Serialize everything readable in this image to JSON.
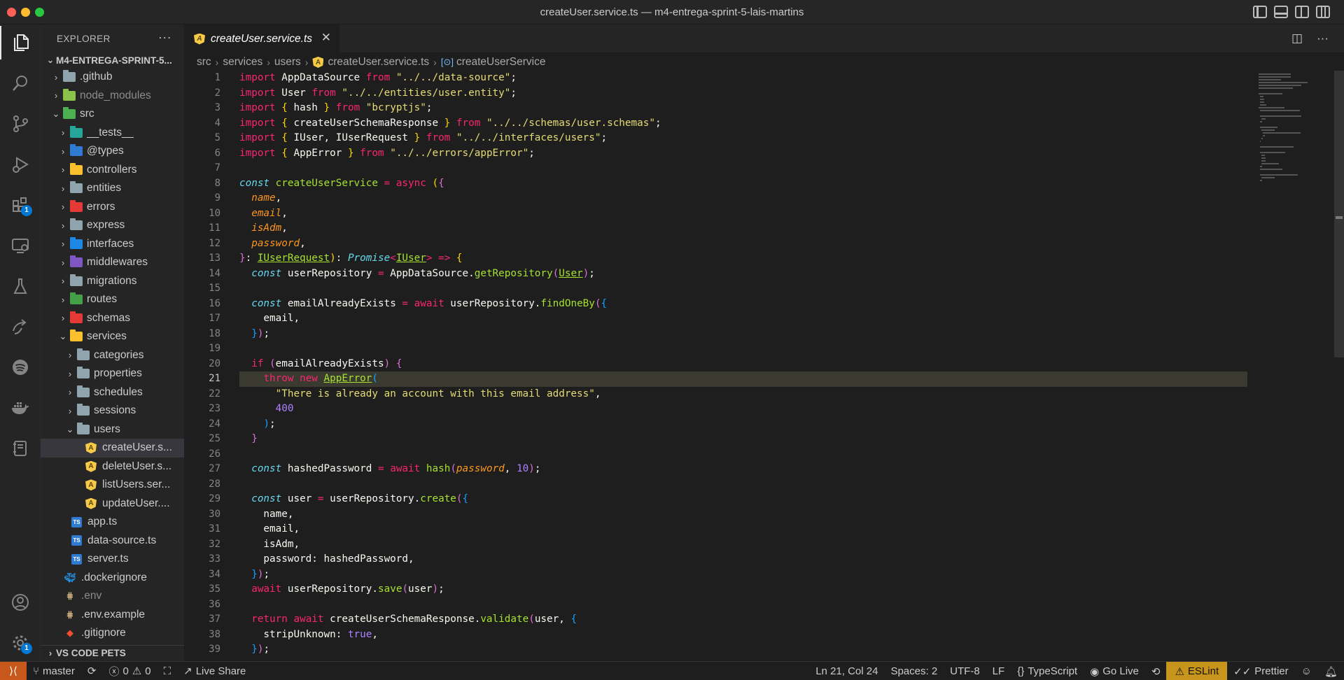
{
  "window": {
    "title": "createUser.service.ts — m4-entrega-sprint-5-lais-martins"
  },
  "activity_bar": {
    "extensions_badge": "1",
    "settings_badge": "1"
  },
  "sidebar": {
    "header": "EXPLORER",
    "root": "M4-ENTREGA-SPRINT-5...",
    "footer": "VS CODE PETS",
    "tree": [
      {
        "label": ".github",
        "kind": "folder",
        "depth": 1,
        "open": false,
        "color": "#90a4ae"
      },
      {
        "label": "node_modules",
        "kind": "folder",
        "depth": 1,
        "open": false,
        "color": "#8bc34a",
        "dim": true
      },
      {
        "label": "src",
        "kind": "folder",
        "depth": 1,
        "open": true,
        "color": "#4caf50"
      },
      {
        "label": "__tests__",
        "kind": "folder",
        "depth": 2,
        "open": false,
        "color": "#26a69a"
      },
      {
        "label": "@types",
        "kind": "folder",
        "depth": 2,
        "open": false,
        "color": "#2f7bd1"
      },
      {
        "label": "controllers",
        "kind": "folder",
        "depth": 2,
        "open": false,
        "color": "#fbc02d"
      },
      {
        "label": "entities",
        "kind": "folder",
        "depth": 2,
        "open": false,
        "color": "#90a4ae"
      },
      {
        "label": "errors",
        "kind": "folder",
        "depth": 2,
        "open": false,
        "color": "#e53935"
      },
      {
        "label": "express",
        "kind": "folder",
        "depth": 2,
        "open": false,
        "color": "#90a4ae"
      },
      {
        "label": "interfaces",
        "kind": "folder",
        "depth": 2,
        "open": false,
        "color": "#1e88e5"
      },
      {
        "label": "middlewares",
        "kind": "folder",
        "depth": 2,
        "open": false,
        "color": "#7e57c2"
      },
      {
        "label": "migrations",
        "kind": "folder",
        "depth": 2,
        "open": false,
        "color": "#90a4ae"
      },
      {
        "label": "routes",
        "kind": "folder",
        "depth": 2,
        "open": false,
        "color": "#43a047"
      },
      {
        "label": "schemas",
        "kind": "folder",
        "depth": 2,
        "open": false,
        "color": "#e53935"
      },
      {
        "label": "services",
        "kind": "folder",
        "depth": 2,
        "open": true,
        "color": "#fbc02d"
      },
      {
        "label": "categories",
        "kind": "folder",
        "depth": 3,
        "open": false,
        "color": "#90a4ae"
      },
      {
        "label": "properties",
        "kind": "folder",
        "depth": 3,
        "open": false,
        "color": "#90a4ae"
      },
      {
        "label": "schedules",
        "kind": "folder",
        "depth": 3,
        "open": false,
        "color": "#90a4ae"
      },
      {
        "label": "sessions",
        "kind": "folder",
        "depth": 3,
        "open": false,
        "color": "#90a4ae"
      },
      {
        "label": "users",
        "kind": "folder",
        "depth": 3,
        "open": true,
        "color": "#90a4ae"
      },
      {
        "label": "createUser.s...",
        "kind": "angular",
        "depth": 4,
        "selected": true
      },
      {
        "label": "deleteUser.s...",
        "kind": "angular",
        "depth": 4
      },
      {
        "label": "listUsers.ser...",
        "kind": "angular",
        "depth": 4
      },
      {
        "label": "updateUser....",
        "kind": "angular",
        "depth": 4
      },
      {
        "label": "app.ts",
        "kind": "ts",
        "depth": 2
      },
      {
        "label": "data-source.ts",
        "kind": "ts",
        "depth": 2
      },
      {
        "label": "server.ts",
        "kind": "ts",
        "depth": 2
      },
      {
        "label": ".dockerignore",
        "kind": "docker",
        "depth": 1
      },
      {
        "label": ".env",
        "kind": "env",
        "depth": 1,
        "dim": true
      },
      {
        "label": ".env.example",
        "kind": "env",
        "depth": 1
      },
      {
        "label": ".gitignore",
        "kind": "git",
        "depth": 1
      }
    ]
  },
  "tab": {
    "label": "createUser.service.ts"
  },
  "breadcrumb": [
    "src",
    "services",
    "users",
    "createUser.service.ts",
    "createUserService"
  ],
  "editor": {
    "current_line": 21,
    "lines": [
      [
        [
          "kw",
          "import"
        ],
        [
          "p",
          " AppDataSource "
        ],
        [
          "kw",
          "from"
        ],
        [
          "p",
          " "
        ],
        [
          "str",
          "\"../../data-source\""
        ],
        [
          "p",
          ";"
        ]
      ],
      [
        [
          "kw",
          "import"
        ],
        [
          "p",
          " User "
        ],
        [
          "kw",
          "from"
        ],
        [
          "p",
          " "
        ],
        [
          "str",
          "\"../../entities/user.entity\""
        ],
        [
          "p",
          ";"
        ]
      ],
      [
        [
          "kw",
          "import"
        ],
        [
          "p",
          " "
        ],
        [
          "b1",
          "{"
        ],
        [
          "p",
          " hash "
        ],
        [
          "b1",
          "}"
        ],
        [
          "p",
          " "
        ],
        [
          "kw",
          "from"
        ],
        [
          "p",
          " "
        ],
        [
          "str",
          "\"bcryptjs\""
        ],
        [
          "p",
          ";"
        ]
      ],
      [
        [
          "kw",
          "import"
        ],
        [
          "p",
          " "
        ],
        [
          "b1",
          "{"
        ],
        [
          "p",
          " createUserSchemaResponse "
        ],
        [
          "b1",
          "}"
        ],
        [
          "p",
          " "
        ],
        [
          "kw",
          "from"
        ],
        [
          "p",
          " "
        ],
        [
          "str",
          "\"../../schemas/user.schemas\""
        ],
        [
          "p",
          ";"
        ]
      ],
      [
        [
          "kw",
          "import"
        ],
        [
          "p",
          " "
        ],
        [
          "b1",
          "{"
        ],
        [
          "p",
          " IUser, IUserRequest "
        ],
        [
          "b1",
          "}"
        ],
        [
          "p",
          " "
        ],
        [
          "kw",
          "from"
        ],
        [
          "p",
          " "
        ],
        [
          "str",
          "\"../../interfaces/users\""
        ],
        [
          "p",
          ";"
        ]
      ],
      [
        [
          "kw",
          "import"
        ],
        [
          "p",
          " "
        ],
        [
          "b1",
          "{"
        ],
        [
          "p",
          " AppError "
        ],
        [
          "b1",
          "}"
        ],
        [
          "p",
          " "
        ],
        [
          "kw",
          "from"
        ],
        [
          "p",
          " "
        ],
        [
          "str",
          "\"../../errors/appError\""
        ],
        [
          "p",
          ";"
        ]
      ],
      [],
      [
        [
          "kw2",
          "const"
        ],
        [
          "p",
          " "
        ],
        [
          "fn",
          "createUserService"
        ],
        [
          "p",
          " "
        ],
        [
          "kw",
          "="
        ],
        [
          "p",
          " "
        ],
        [
          "kw",
          "async"
        ],
        [
          "p",
          " "
        ],
        [
          "b1",
          "("
        ],
        [
          "b2",
          "{"
        ]
      ],
      [
        [
          "p",
          "  "
        ],
        [
          "param",
          "name"
        ],
        [
          "p",
          ","
        ]
      ],
      [
        [
          "p",
          "  "
        ],
        [
          "param",
          "email"
        ],
        [
          "p",
          ","
        ]
      ],
      [
        [
          "p",
          "  "
        ],
        [
          "param",
          "isAdm"
        ],
        [
          "p",
          ","
        ]
      ],
      [
        [
          "p",
          "  "
        ],
        [
          "param",
          "password"
        ],
        [
          "p",
          ","
        ]
      ],
      [
        [
          "b2",
          "}"
        ],
        [
          "p",
          ": "
        ],
        [
          "ty",
          "IUserRequest"
        ],
        [
          "b1",
          ")"
        ],
        [
          "p",
          ": "
        ],
        [
          "tyi",
          "Promise"
        ],
        [
          "kw",
          "<"
        ],
        [
          "ty",
          "IUser"
        ],
        [
          "kw",
          ">"
        ],
        [
          "p",
          " "
        ],
        [
          "kw",
          "=>"
        ],
        [
          "p",
          " "
        ],
        [
          "b1",
          "{"
        ]
      ],
      [
        [
          "p",
          "  "
        ],
        [
          "kw2",
          "const"
        ],
        [
          "p",
          " userRepository "
        ],
        [
          "kw",
          "="
        ],
        [
          "p",
          " AppDataSource."
        ],
        [
          "fn",
          "getRepository"
        ],
        [
          "b2",
          "("
        ],
        [
          "ty",
          "User"
        ],
        [
          "b2",
          ")"
        ],
        [
          "p",
          ";"
        ]
      ],
      [],
      [
        [
          "p",
          "  "
        ],
        [
          "kw2",
          "const"
        ],
        [
          "p",
          " emailAlreadyExists "
        ],
        [
          "kw",
          "="
        ],
        [
          "p",
          " "
        ],
        [
          "kw",
          "await"
        ],
        [
          "p",
          " userRepository."
        ],
        [
          "fn",
          "findOneBy"
        ],
        [
          "b2",
          "("
        ],
        [
          "b3",
          "{"
        ]
      ],
      [
        [
          "p",
          "    email,"
        ]
      ],
      [
        [
          "p",
          "  "
        ],
        [
          "b3",
          "}"
        ],
        [
          "b2",
          ")"
        ],
        [
          "p",
          ";"
        ]
      ],
      [],
      [
        [
          "p",
          "  "
        ],
        [
          "kw",
          "if"
        ],
        [
          "p",
          " "
        ],
        [
          "b2",
          "("
        ],
        [
          "p",
          "emailAlreadyExists"
        ],
        [
          "b2",
          ")"
        ],
        [
          "p",
          " "
        ],
        [
          "b2",
          "{"
        ]
      ],
      [
        [
          "p",
          "    "
        ],
        [
          "kw",
          "throw"
        ],
        [
          "p",
          " "
        ],
        [
          "kw",
          "new"
        ],
        [
          "p",
          " "
        ],
        [
          "ty",
          "AppError"
        ],
        [
          "b3",
          "("
        ]
      ],
      [
        [
          "p",
          "      "
        ],
        [
          "str",
          "\"There is already an account with this email address\""
        ],
        [
          "p",
          ","
        ]
      ],
      [
        [
          "p",
          "      "
        ],
        [
          "num",
          "400"
        ]
      ],
      [
        [
          "p",
          "    "
        ],
        [
          "b3",
          ")"
        ],
        [
          "p",
          ";"
        ]
      ],
      [
        [
          "p",
          "  "
        ],
        [
          "b2",
          "}"
        ]
      ],
      [],
      [
        [
          "p",
          "  "
        ],
        [
          "kw2",
          "const"
        ],
        [
          "p",
          " hashedPassword "
        ],
        [
          "kw",
          "="
        ],
        [
          "p",
          " "
        ],
        [
          "kw",
          "await"
        ],
        [
          "p",
          " "
        ],
        [
          "fn",
          "hash"
        ],
        [
          "b2",
          "("
        ],
        [
          "param",
          "password"
        ],
        [
          "p",
          ", "
        ],
        [
          "num",
          "10"
        ],
        [
          "b2",
          ")"
        ],
        [
          "p",
          ";"
        ]
      ],
      [],
      [
        [
          "p",
          "  "
        ],
        [
          "kw2",
          "const"
        ],
        [
          "p",
          " user "
        ],
        [
          "kw",
          "="
        ],
        [
          "p",
          " userRepository."
        ],
        [
          "fn",
          "create"
        ],
        [
          "b2",
          "("
        ],
        [
          "b3",
          "{"
        ]
      ],
      [
        [
          "p",
          "    name,"
        ]
      ],
      [
        [
          "p",
          "    email,"
        ]
      ],
      [
        [
          "p",
          "    isAdm,"
        ]
      ],
      [
        [
          "p",
          "    password: hashedPassword,"
        ]
      ],
      [
        [
          "p",
          "  "
        ],
        [
          "b3",
          "}"
        ],
        [
          "b2",
          ")"
        ],
        [
          "p",
          ";"
        ]
      ],
      [
        [
          "p",
          "  "
        ],
        [
          "kw",
          "await"
        ],
        [
          "p",
          " userRepository."
        ],
        [
          "fn",
          "save"
        ],
        [
          "b2",
          "("
        ],
        [
          "p",
          "user"
        ],
        [
          "b2",
          ")"
        ],
        [
          "p",
          ";"
        ]
      ],
      [],
      [
        [
          "p",
          "  "
        ],
        [
          "kw",
          "return"
        ],
        [
          "p",
          " "
        ],
        [
          "kw",
          "await"
        ],
        [
          "p",
          " createUserSchemaResponse."
        ],
        [
          "fn",
          "validate"
        ],
        [
          "b2",
          "("
        ],
        [
          "p",
          "user, "
        ],
        [
          "b3",
          "{"
        ]
      ],
      [
        [
          "p",
          "    stripUnknown: "
        ],
        [
          "num",
          "true"
        ],
        [
          "p",
          ","
        ]
      ],
      [
        [
          "p",
          "  "
        ],
        [
          "b3",
          "}"
        ],
        [
          "b2",
          ")"
        ],
        [
          "p",
          ";"
        ]
      ]
    ]
  },
  "statusbar": {
    "branch": "master",
    "errors": "0",
    "warnings": "0",
    "live_share": "Live Share",
    "position": "Ln 21, Col 24",
    "spaces": "Spaces: 2",
    "encoding": "UTF-8",
    "eol": "LF",
    "language": "TypeScript",
    "go_live": "Go Live",
    "eslint": "ESLint",
    "prettier": "Prettier"
  }
}
